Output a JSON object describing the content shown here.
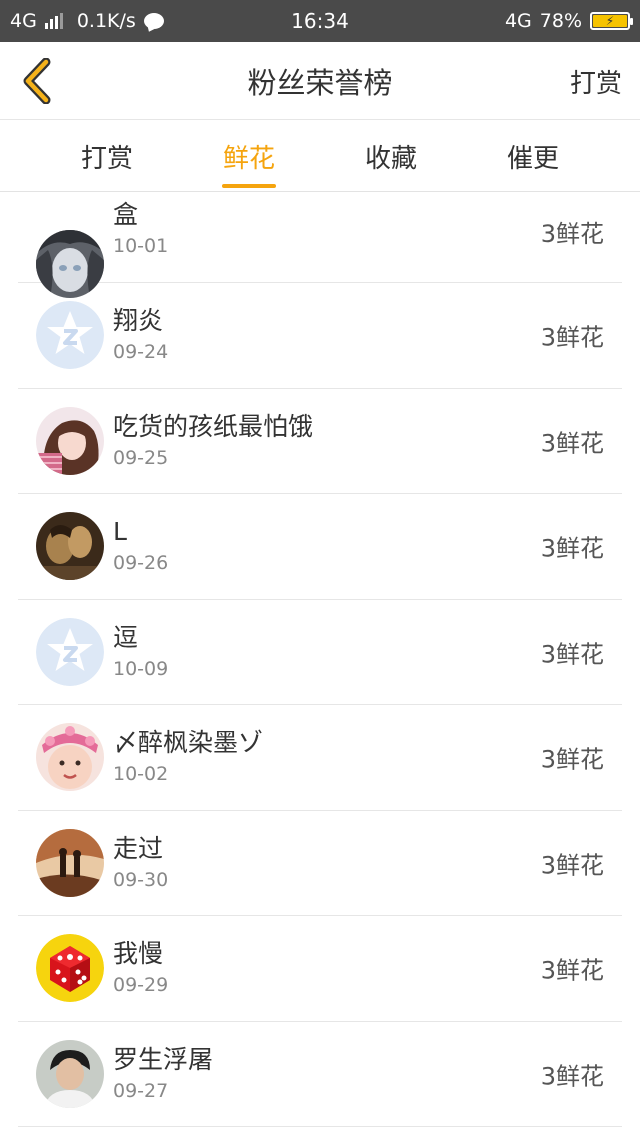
{
  "status_bar": {
    "network": "4G",
    "speed": "0.1K/s",
    "time": "16:34",
    "network_right": "4G",
    "battery": "78%"
  },
  "header": {
    "back_icon": "chevron-left-icon",
    "title": "粉丝荣誉榜",
    "action": "打赏"
  },
  "tabs": [
    {
      "label": "打赏",
      "active": false
    },
    {
      "label": "鲜花",
      "active": true
    },
    {
      "label": "收藏",
      "active": false
    },
    {
      "label": "催更",
      "active": false
    }
  ],
  "colors": {
    "accent": "#f5a40e",
    "status_bar_bg": "#4a4a4a",
    "divider": "#e6e6e6"
  },
  "rows": [
    {
      "name": "盒",
      "date": "10-01",
      "amount": "3鲜花",
      "avatar": "anime-avatar"
    },
    {
      "name": "翔炎",
      "date": "09-24",
      "amount": "3鲜花",
      "avatar": "default-qq-avatar"
    },
    {
      "name": "吃货的孩纸最怕饿",
      "date": "09-25",
      "amount": "3鲜花",
      "avatar": "girl-photo-avatar"
    },
    {
      "name": "L",
      "date": "09-26",
      "amount": "3鲜花",
      "avatar": "sepia-photo-avatar"
    },
    {
      "name": "逗",
      "date": "10-09",
      "amount": "3鲜花",
      "avatar": "default-qq-avatar"
    },
    {
      "name": "〆醉枫染墨ゾ",
      "date": "10-02",
      "amount": "3鲜花",
      "avatar": "baby-photo-avatar"
    },
    {
      "name": "走过",
      "date": "09-30",
      "amount": "3鲜花",
      "avatar": "sunset-couple-avatar"
    },
    {
      "name": "我慢",
      "date": "09-29",
      "amount": "3鲜花",
      "avatar": "red-dice-avatar"
    },
    {
      "name": "罗生浮屠",
      "date": "09-27",
      "amount": "3鲜花",
      "avatar": "boy-photo-avatar"
    }
  ]
}
